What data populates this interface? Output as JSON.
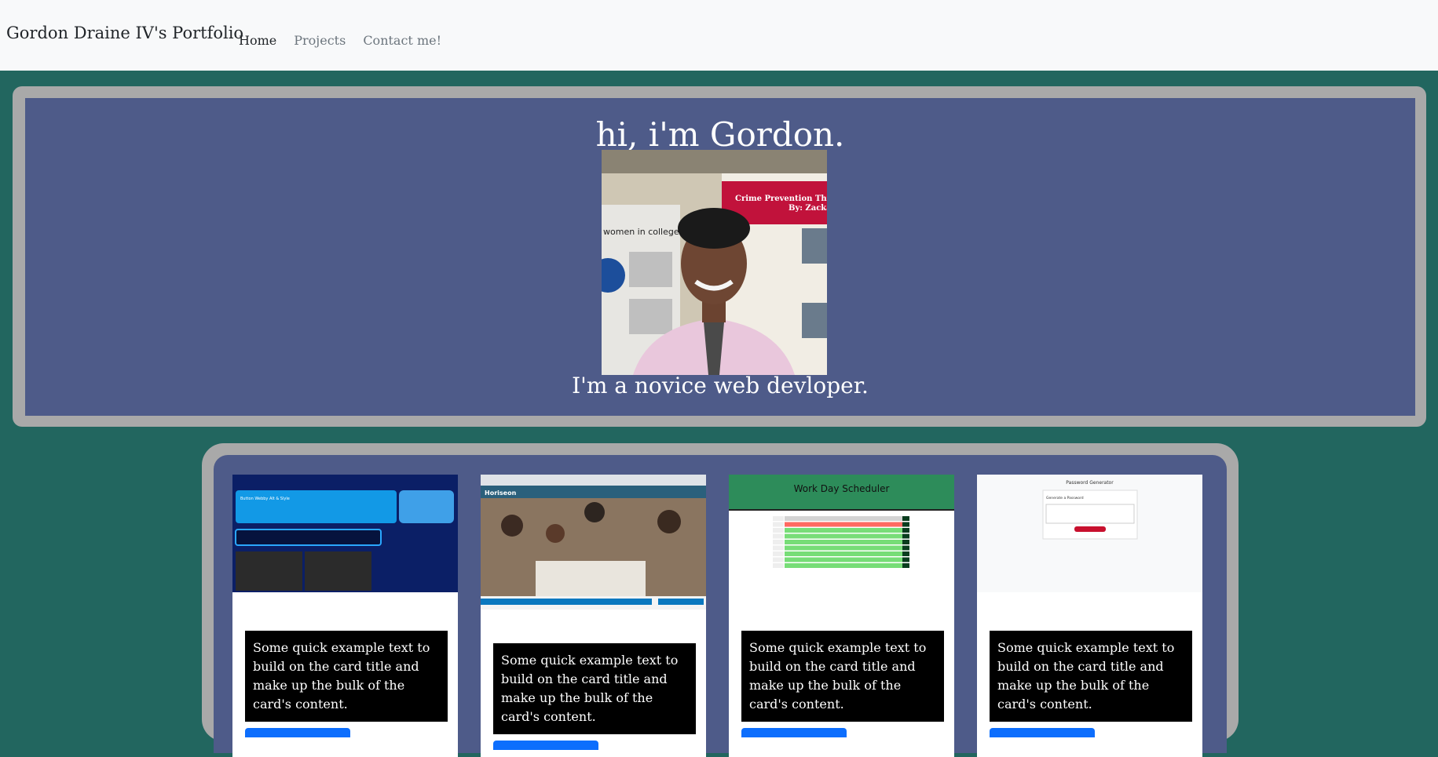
{
  "nav": {
    "brand": "Gordon Draine IV's Portfolio",
    "links": [
      "Home",
      "Projects",
      "Contact me!"
    ]
  },
  "hero": {
    "title": "hi, i'm Gordon.",
    "subtitle": "I'm a novice web devloper.",
    "poster_text_1": "women in college",
    "poster_text_2": "Crime Prevention Through En",
    "poster_text_3": "By: Zackary"
  },
  "cards": [
    {
      "text": "Some quick example text to build on the card title and make up the bulk of the card's content.",
      "thumb_title": "Button Webby Alt & Slyle"
    },
    {
      "text": "Some quick example text to build on the card title and make up the bulk of the card's content.",
      "thumb_title": "Horiseon"
    },
    {
      "text": "Some quick example text to build on the card title and make up the bulk of the card's content.",
      "thumb_title": "Work Day Scheduler"
    },
    {
      "text": "Some quick example text to build on the card title and make up the bulk of the card's content.",
      "thumb_title": "Password Generator",
      "thumb_sub": "Generate a Password"
    }
  ],
  "colors": {
    "page_bg": "#22665f",
    "hero_bg": "#4e5b89",
    "frame": "#a9a9a9",
    "button": "#0d6efd"
  }
}
